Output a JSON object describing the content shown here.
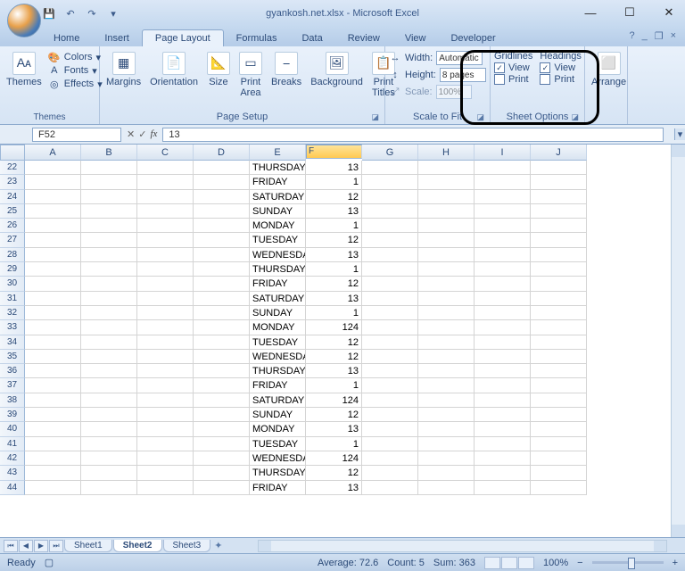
{
  "window": {
    "title": "gyankosh.net.xlsx - Microsoft Excel",
    "min": "—",
    "max": "☐",
    "close": "✕"
  },
  "tabs": {
    "items": [
      "Home",
      "Insert",
      "Page Layout",
      "Formulas",
      "Data",
      "Review",
      "View",
      "Developer"
    ],
    "active": "Page Layout"
  },
  "ribbon": {
    "themes": {
      "label": "Themes",
      "main": "Themes",
      "colors": "Colors",
      "fonts": "Fonts",
      "effects": "Effects"
    },
    "pageSetup": {
      "label": "Page Setup",
      "margins": "Margins",
      "orientation": "Orientation",
      "size": "Size",
      "printArea": "Print\nArea",
      "breaks": "Breaks",
      "background": "Background",
      "printTitles": "Print\nTitles"
    },
    "scaleToFit": {
      "label": "Scale to Fit",
      "width": "Width:",
      "height": "Height:",
      "scale": "Scale:",
      "widthVal": "Automatic",
      "heightVal": "8 pages",
      "scaleVal": "100%"
    },
    "sheetOptions": {
      "label": "Sheet Options",
      "gridlines": "Gridlines",
      "headings": "Headings",
      "view": "View",
      "print": "Print"
    },
    "arrange": {
      "label": "Arrange",
      "main": "Arrange"
    }
  },
  "nameBox": "F52",
  "formulaBar": "13",
  "columns": [
    "A",
    "B",
    "C",
    "D",
    "E",
    "F",
    "G",
    "H",
    "I",
    "J"
  ],
  "selectedCol": "F",
  "rows": [
    {
      "n": 22,
      "e": "THURSDAY",
      "f": "13"
    },
    {
      "n": 23,
      "e": "FRIDAY",
      "f": "1"
    },
    {
      "n": 24,
      "e": "SATURDAY",
      "f": "12"
    },
    {
      "n": 25,
      "e": "SUNDAY",
      "f": "13"
    },
    {
      "n": 26,
      "e": "MONDAY",
      "f": "1"
    },
    {
      "n": 27,
      "e": "TUESDAY",
      "f": "12"
    },
    {
      "n": 28,
      "e": "WEDNESDAY",
      "f": "13"
    },
    {
      "n": 29,
      "e": "THURSDAY",
      "f": "1"
    },
    {
      "n": 30,
      "e": "FRIDAY",
      "f": "12"
    },
    {
      "n": 31,
      "e": "SATURDAY",
      "f": "13"
    },
    {
      "n": 32,
      "e": "SUNDAY",
      "f": "1"
    },
    {
      "n": 33,
      "e": "MONDAY",
      "f": "124"
    },
    {
      "n": 34,
      "e": "TUESDAY",
      "f": "12"
    },
    {
      "n": 35,
      "e": "WEDNESDAY",
      "f": "12"
    },
    {
      "n": 36,
      "e": "THURSDAY",
      "f": "13"
    },
    {
      "n": 37,
      "e": "FRIDAY",
      "f": "1"
    },
    {
      "n": 38,
      "e": "SATURDAY",
      "f": "124"
    },
    {
      "n": 39,
      "e": "SUNDAY",
      "f": "12"
    },
    {
      "n": 40,
      "e": "MONDAY",
      "f": "13"
    },
    {
      "n": 41,
      "e": "TUESDAY",
      "f": "1"
    },
    {
      "n": 42,
      "e": "WEDNESDAY",
      "f": "124"
    },
    {
      "n": 43,
      "e": "THURSDAY",
      "f": "12"
    },
    {
      "n": 44,
      "e": "FRIDAY",
      "f": "13"
    }
  ],
  "sheets": {
    "items": [
      "Sheet1",
      "Sheet2",
      "Sheet3"
    ],
    "active": "Sheet2"
  },
  "status": {
    "ready": "Ready",
    "average": "Average: 72.6",
    "count": "Count: 5",
    "sum": "Sum: 363",
    "zoom": "100%",
    "zoomMinus": "−",
    "zoomPlus": "+"
  }
}
